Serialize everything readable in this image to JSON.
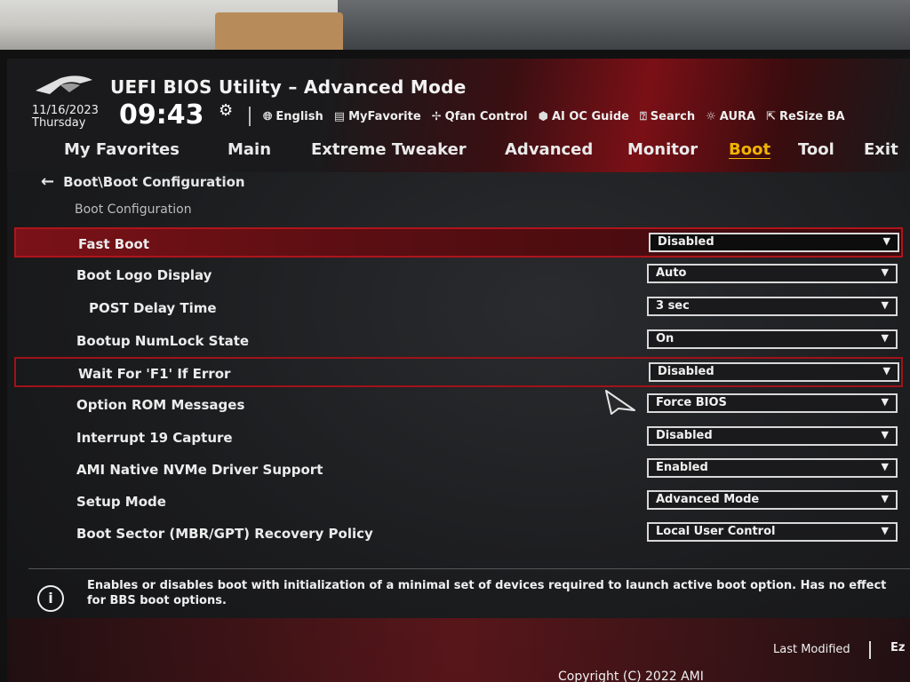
{
  "header": {
    "title": "UEFI BIOS Utility – Advanced Mode",
    "date": "11/16/2023",
    "weekday": "Thursday",
    "time": "09:43",
    "tools": [
      {
        "label": "English",
        "icon": "globe-icon"
      },
      {
        "label": "MyFavorite",
        "icon": "favorite-icon"
      },
      {
        "label": "Qfan Control",
        "icon": "fan-icon"
      },
      {
        "label": "AI OC Guide",
        "icon": "ai-oc-icon"
      },
      {
        "label": "Search",
        "icon": "search-icon"
      },
      {
        "label": "AURA",
        "icon": "aura-icon"
      },
      {
        "label": "ReSize BA",
        "icon": "resize-bar-icon"
      }
    ]
  },
  "nav": {
    "tabs": [
      "My Favorites",
      "Main",
      "Extreme Tweaker",
      "Advanced",
      "Monitor",
      "Boot",
      "Tool",
      "Exit"
    ],
    "active": "Boot"
  },
  "breadcrumb": "Boot\\Boot Configuration",
  "section_title": "Boot Configuration",
  "settings": [
    {
      "label": "Fast Boot",
      "value": "Disabled"
    },
    {
      "label": "Boot Logo Display",
      "value": "Auto"
    },
    {
      "label": "POST Delay Time",
      "value": "3 sec"
    },
    {
      "label": "Bootup NumLock State",
      "value": "On"
    },
    {
      "label": "Wait For 'F1' If Error",
      "value": "Disabled"
    },
    {
      "label": "Option ROM Messages",
      "value": "Force BIOS"
    },
    {
      "label": "Interrupt 19 Capture",
      "value": "Disabled"
    },
    {
      "label": "AMI Native NVMe Driver Support",
      "value": "Enabled"
    },
    {
      "label": "Setup Mode",
      "value": "Advanced Mode"
    },
    {
      "label": "Boot Sector (MBR/GPT) Recovery Policy",
      "value": "Local User Control"
    }
  ],
  "help_text": "Enables or disables boot with initialization of a minimal set of devices required to launch active boot option. Has no effect for BBS boot options.",
  "footer": {
    "last_modified": "Last Modified",
    "ez_mode": "Ez",
    "copyright": "Copyright (C) 2022 AMI"
  },
  "colors": {
    "accent": "#f0b400",
    "highlight_red": "#b0141c"
  }
}
